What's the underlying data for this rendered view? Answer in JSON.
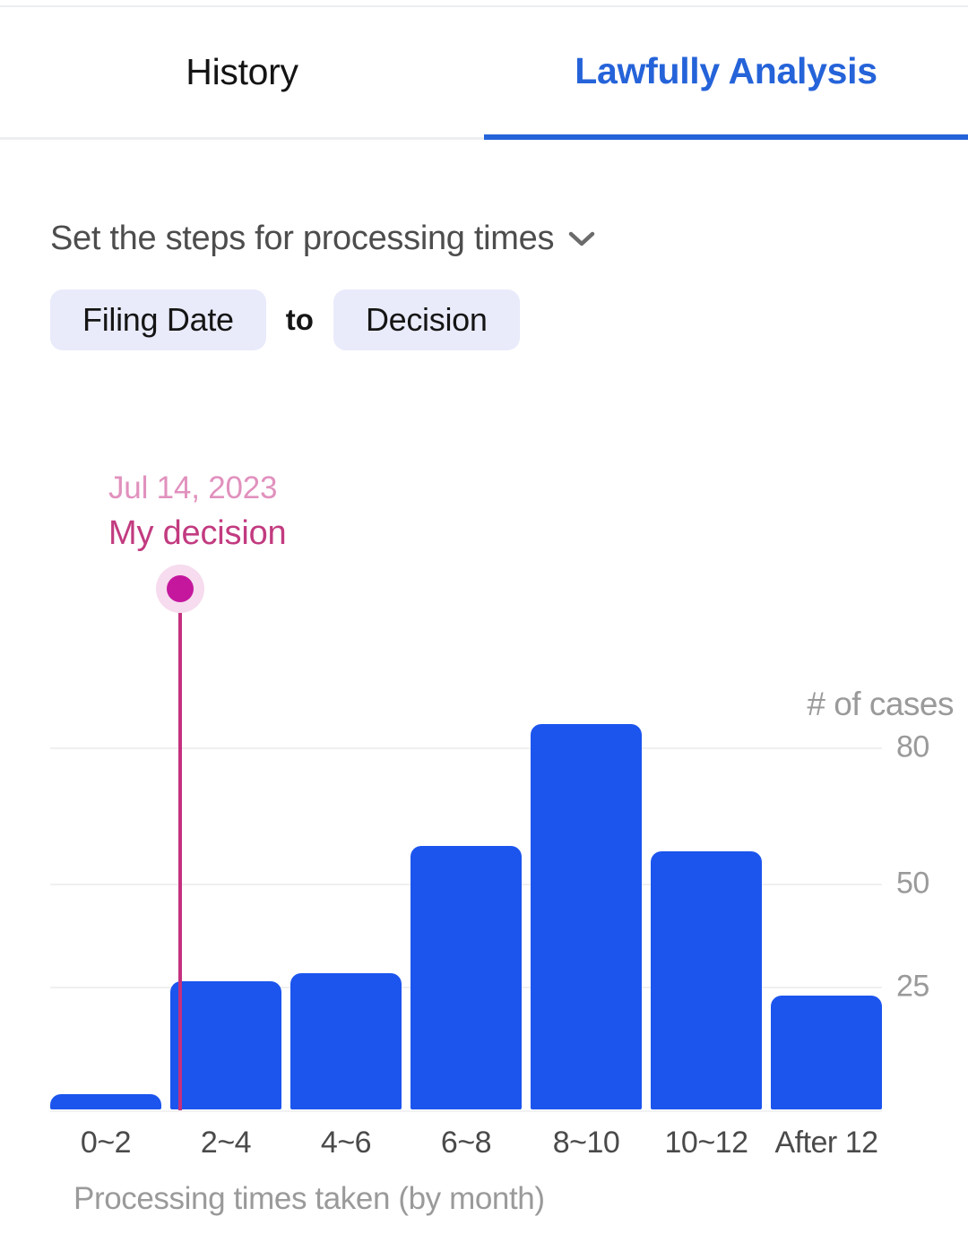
{
  "tabs": [
    {
      "label": "History",
      "active": false
    },
    {
      "label": "Lawfully Analysis",
      "active": true
    }
  ],
  "controls": {
    "steps_title": "Set the steps for processing times",
    "chevron_icon": "chevron-down-icon",
    "from_chip": "Filing Date",
    "separator": "to",
    "to_chip": "Decision"
  },
  "marker": {
    "date": "Jul 14, 2023",
    "label": "My decision",
    "dot_color": "#C4179E",
    "halo_color": "#F6DCEE",
    "line_color": "#C4317E",
    "date_color": "#E191BE",
    "label_color": "#C23B80"
  },
  "colors": {
    "bar": "#1C55EE",
    "accent": "#2563D9",
    "chip_bg": "#E9EBFB",
    "grid": "#f0f0f0",
    "muted_text": "#9a9a9a"
  },
  "chart_data": {
    "type": "bar",
    "title": "",
    "xlabel": "Processing times taken (by month)",
    "ylabel": "# of cases",
    "categories": [
      "0~2",
      "2~4",
      "4~6",
      "6~8",
      "8~10",
      "10~12",
      "After 12"
    ],
    "values": [
      3,
      26,
      28,
      58,
      85,
      57,
      23
    ],
    "yticks": [
      80,
      50,
      25
    ],
    "ytick_positions": [
      405,
      253,
      138
    ],
    "ylim": [
      0,
      92
    ],
    "grid": true,
    "legend": false,
    "annotation": {
      "type": "vertical-line-marker",
      "at_category_boundary": "between 0~2 and 2~4",
      "date": "Jul 14, 2023",
      "label": "My decision"
    }
  }
}
